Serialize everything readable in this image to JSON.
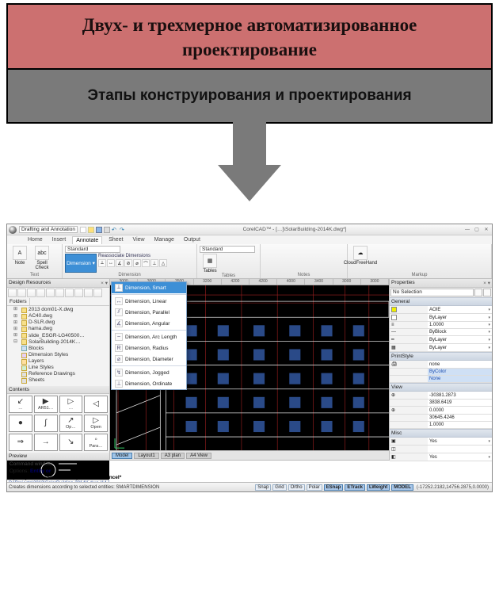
{
  "diagram": {
    "title_line1": "Двух- и трехмерное автоматизированное",
    "title_line2": "проектирование",
    "subtitle": "Этапы конструирования и проектирования"
  },
  "cad": {
    "workspace": "Drafting and Annotation",
    "doc_title": "CorelCAD™ - […]\\SolarBuilding-2014K.dwg*]",
    "tabs": {
      "home": "Home",
      "insert": "Insert",
      "annotate": "Annotate",
      "sheet": "Sheet",
      "view": "View",
      "manage": "Manage",
      "output": "Output"
    },
    "ribbon": {
      "text_grp": "Text",
      "note_btn": "Note",
      "spell_btn": "Spell\nCheck",
      "dim_grp": "Dimension",
      "dim_btn": "Dimension",
      "reassoc": "Reassociate Dimensions",
      "standard1": "Standard",
      "tables_grp": "Tables",
      "tables_btn": "Tables",
      "notes_grp": "Notes",
      "markup_grp": "Markup",
      "cloud_btn": "CloudFreeHand"
    },
    "dim_menu": {
      "smart": "Dimension, Smart",
      "linear": "Dimension, Linear",
      "parallel": "Dimension, Parallel",
      "angular": "Dimension, Angular",
      "arclen": "Dimension, Arc Length",
      "radius": "Dimension, Radius",
      "diameter": "Dimension, Diameter",
      "jogged": "Dimension, Jogged",
      "ordinate": "Dimension, Ordinate"
    },
    "left": {
      "design_res": "Design Resources",
      "folders_tab": "Folders",
      "tree": [
        "2013 dom01-X.dwg",
        "AC40.dwg",
        "D-SLR.dwg",
        "hama.dwg",
        "slide_ESGR-LG40500…",
        "SolarBuilding-2014K…",
        "Blocks",
        "Dimension Styles",
        "Layers",
        "Line Styles",
        "Reference Drawings",
        "Sheets"
      ],
      "contents": "Contents",
      "cells": [
        "…",
        "AR51…",
        "…",
        "",
        "",
        "",
        "Op…",
        "Open",
        "",
        "",
        "",
        "Para…"
      ],
      "preview": "Preview",
      "path": "D:\\Projects\\2013\\SolarBuilding-2014K.dwg (14 Blocks)"
    },
    "ruler": [
      "3000",
      "3000",
      "3500",
      "3200",
      "4200",
      "4200",
      "4000",
      "3400",
      "3000",
      "3000"
    ],
    "model_tabs": {
      "model": "Model",
      "l1": "Layout1",
      "l2": "A3 plan",
      "l3": "A4 View"
    },
    "right": {
      "title": "Properties",
      "no_sel": "No Selection",
      "sec_general": "General",
      "g1k": "",
      "g1v": "AOIE",
      "g2k": "",
      "g2v": "ByLayer",
      "g3k": "",
      "g3v": "1.0000",
      "g4k": "",
      "g4v": "ByBlock",
      "g5k": "",
      "g5v": "ByLayer",
      "g6k": "",
      "g6v": "ByLayer",
      "sec_print": "PrintStyle",
      "p1k": "",
      "p1v": "none",
      "p2k": "",
      "p2v": "ByColor",
      "p3k": "",
      "p3v": "None",
      "sec_view": "View",
      "v1": "-30381.2873",
      "v2": "3838.6419",
      "v3": "0.0000",
      "v4": "30645.4246",
      "v5": "1.0000",
      "sec_misc": "Misc",
      "m1v": "Yes",
      "m2v": "",
      "m3v": "Yes"
    },
    "cmd": {
      "title": "Command window",
      "options_lbl": "Options:",
      "options_val": "Entity or",
      "prompt": "Specify first extension line position» *Cancel*"
    },
    "status": {
      "left": "Creates dimensions according to selected entities: SMARTDIMENSION",
      "snap": "Snap",
      "grid": "Grid",
      "ortho": "Ortho",
      "polar": "Polar",
      "esnap": "ESnap",
      "etrack": "ETrack",
      "lweight": "LWeight",
      "model": "MODEL",
      "coords": "(-17252.2182,14756.2875,0.0000)"
    }
  }
}
